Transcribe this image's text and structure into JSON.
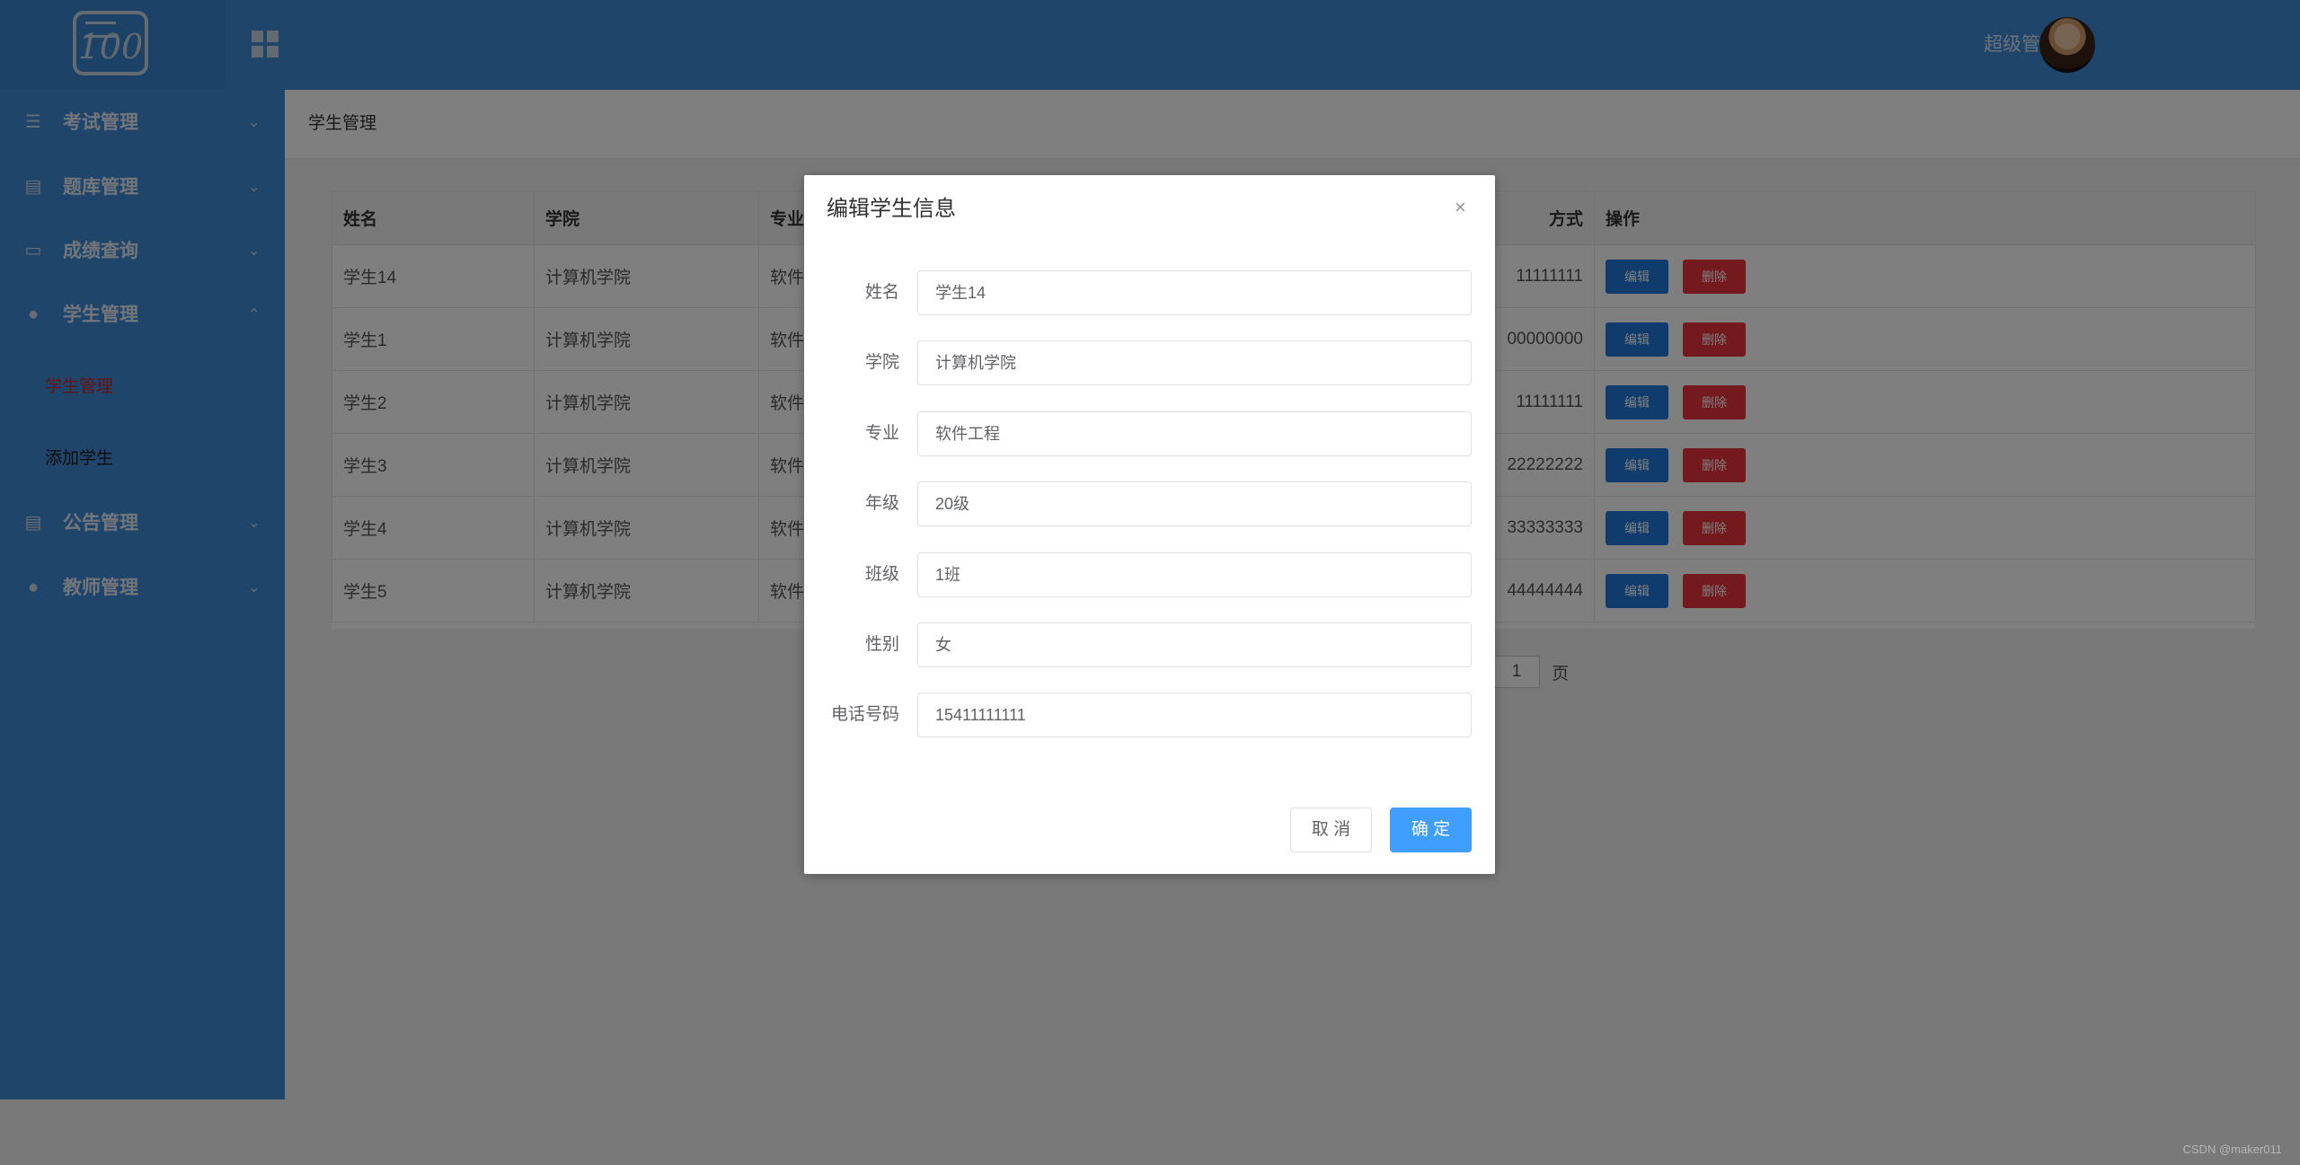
{
  "header": {
    "logo_text": "100",
    "user_name": "超级管理员"
  },
  "sidebar": {
    "items": [
      {
        "label": "考试管理",
        "icon": "list-icon"
      },
      {
        "label": "题库管理",
        "icon": "document-icon"
      },
      {
        "label": "成绩查询",
        "icon": "card-icon"
      },
      {
        "label": "学生管理",
        "icon": "user-icon",
        "expanded": true,
        "children": [
          {
            "label": "学生管理",
            "active": true
          },
          {
            "label": "添加学生",
            "active": false
          }
        ]
      },
      {
        "label": "公告管理",
        "icon": "document-icon"
      },
      {
        "label": "教师管理",
        "icon": "user-icon"
      }
    ]
  },
  "breadcrumb": "学生管理",
  "table": {
    "headers": [
      "姓名",
      "学院",
      "专业",
      "方式",
      "操作"
    ],
    "rows": [
      {
        "name": "学生14",
        "college": "计算机学院",
        "major": "软件工",
        "phone": "11111111"
      },
      {
        "name": "学生1",
        "college": "计算机学院",
        "major": "软件工",
        "phone": "00000000"
      },
      {
        "name": "学生2",
        "college": "计算机学院",
        "major": "软件工",
        "phone": "11111111"
      },
      {
        "name": "学生3",
        "college": "计算机学院",
        "major": "软件工",
        "phone": "22222222"
      },
      {
        "name": "学生4",
        "college": "计算机学院",
        "major": "软件工",
        "phone": "33333333"
      },
      {
        "name": "学生5",
        "college": "计算机学院",
        "major": "软件工",
        "phone": "44444444"
      }
    ],
    "edit_label": "编辑",
    "delete_label": "删除"
  },
  "pager": {
    "page": "1",
    "suffix": "页"
  },
  "dialog": {
    "title": "编辑学生信息",
    "close": "×",
    "fields": [
      {
        "label": "姓名",
        "value": "学生14"
      },
      {
        "label": "学院",
        "value": "计算机学院"
      },
      {
        "label": "专业",
        "value": "软件工程"
      },
      {
        "label": "年级",
        "value": "20级"
      },
      {
        "label": "班级",
        "value": "1班"
      },
      {
        "label": "性别",
        "value": "女"
      },
      {
        "label": "电话号码",
        "value": "15411111111"
      }
    ],
    "cancel_label": "取 消",
    "ok_label": "确 定"
  },
  "watermark": "CSDN @maker011",
  "colors": {
    "primary": "#3f8ad6",
    "button_primary": "#409eff",
    "danger": "#e8323c",
    "active_submenu": "#c62828"
  }
}
